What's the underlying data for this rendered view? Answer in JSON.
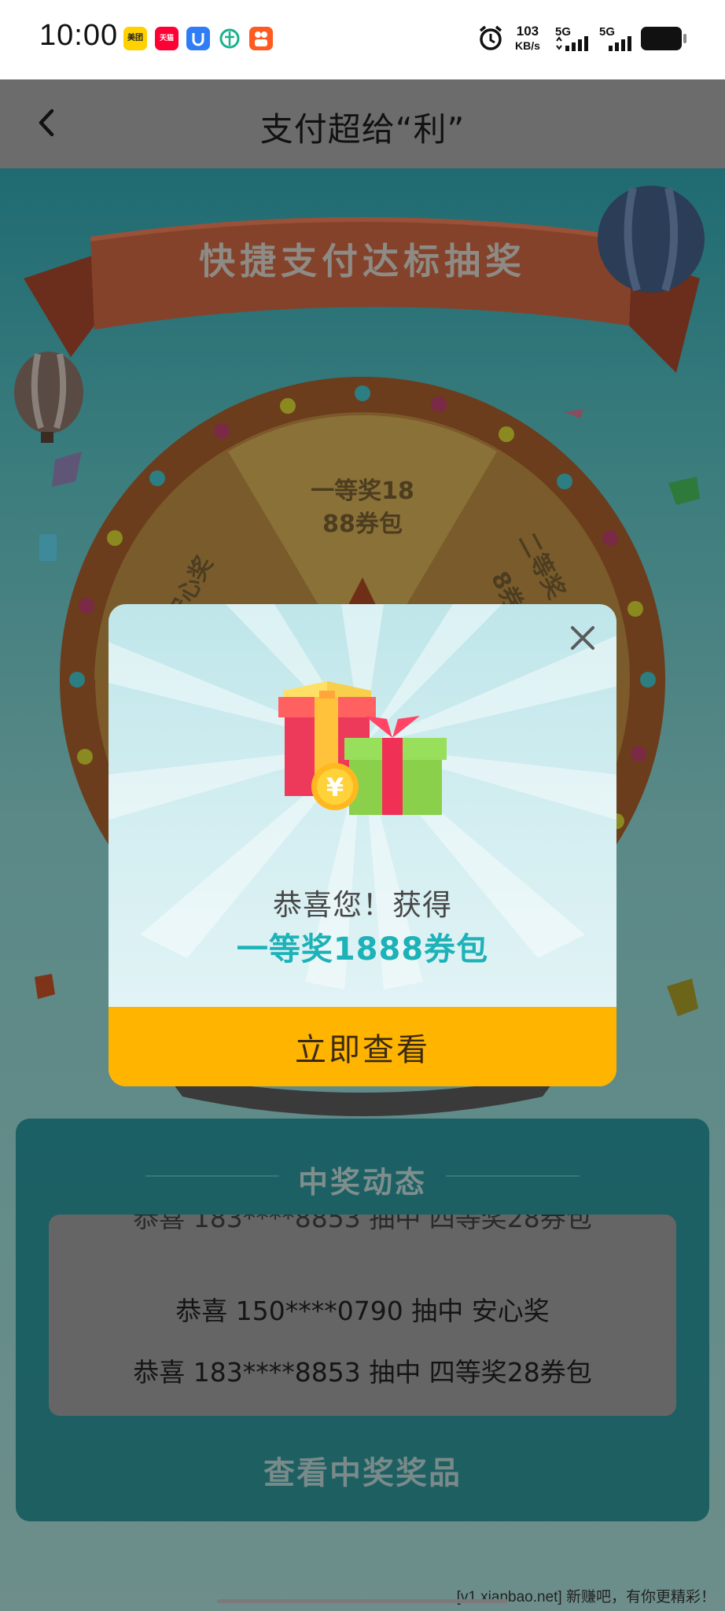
{
  "status_bar": {
    "time": "10:00",
    "apps": [
      {
        "icon": "meituan-app-icon",
        "label": "美团",
        "color": "#ffd100"
      },
      {
        "icon": "tmall-app-icon",
        "label": "天猫",
        "color": "#ff0036"
      },
      {
        "icon": "baidu-netdisk-app-icon",
        "label": "",
        "color": "#2f7cf6"
      },
      {
        "icon": "green-app-icon",
        "label": "",
        "color": "#19b28e"
      },
      {
        "icon": "kuaishou-app-icon",
        "label": "",
        "color": "#ff5a1f"
      }
    ],
    "speed_value": "103",
    "speed_unit": "KB/s",
    "net1": "5G",
    "net2": "5G"
  },
  "nav": {
    "title": "支付超给“利”"
  },
  "page": {
    "banner_title": "快捷支付达标抽奖",
    "wheel_labels": [
      "一等奖18",
      "88券包",
      "安心奖",
      "二等奖",
      "8券"
    ],
    "winners_title": "中奖动态",
    "winners": [
      "恭喜 150****0790 抽中 安心奖",
      "恭喜 183****8853 抽中 四等奖28券包"
    ],
    "view_prizes": "查看中奖奖品",
    "watermark": "[v1.xianbao.net] 新赚吧，有你更精彩！"
  },
  "modal": {
    "congrats": "恭喜您！获得",
    "prize": "一等奖1888券包",
    "button": "立即查看",
    "accent_color": "#1cb2b8",
    "button_color": "#ffb400"
  }
}
